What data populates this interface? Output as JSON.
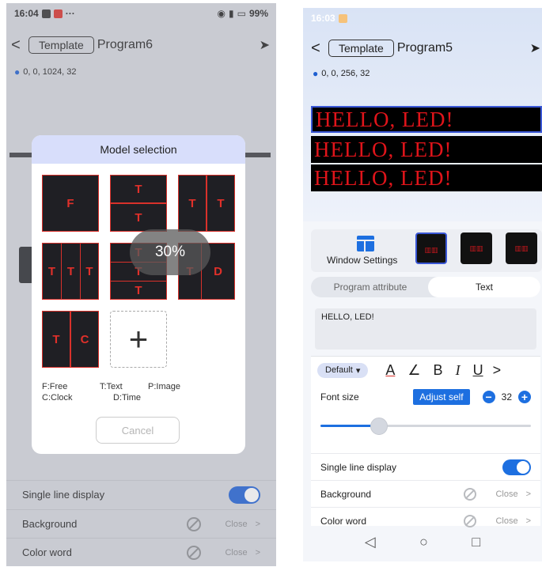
{
  "left": {
    "status": {
      "time": "16:04",
      "battery": "99%",
      "dots": "···"
    },
    "nav": {
      "back": "<",
      "template_label": "Template",
      "title": "Program6",
      "send": "➤"
    },
    "coords": "0, 0, 1024, 32",
    "rows": {
      "single_line": "Single line display",
      "background": "Background",
      "background_value": "Close",
      "color_word": "Color word",
      "color_word_value": "Close",
      "chevron": ">"
    },
    "modal": {
      "title": "Model selection",
      "templates": [
        {
          "cells": [
            "F"
          ]
        },
        {
          "cells": [
            "T",
            "T"
          ]
        },
        {
          "cells": [
            "T",
            "T"
          ]
        },
        {
          "cells": [
            "T",
            "T",
            "T"
          ]
        },
        {
          "cells": [
            "T",
            "T",
            "T"
          ]
        },
        {
          "cells": [
            "T",
            "D"
          ]
        },
        {
          "cells": [
            "T",
            "C"
          ]
        }
      ],
      "add_symbol": "+",
      "legend": {
        "free": "F:Free",
        "text": "T:Text",
        "image": "P:Image",
        "clock": "C:Clock",
        "time": "D:Time"
      },
      "cancel_label": "Cancel"
    },
    "progress": "30%"
  },
  "right": {
    "status": {
      "time": "16:03"
    },
    "nav": {
      "back": "<",
      "template_label": "Template",
      "title": "Program5",
      "send": "➤"
    },
    "coords": "0, 0, 256, 32",
    "led_text": "HELLO, LED!",
    "window_settings_label": "Window Settings",
    "tabs": {
      "attribute": "Program attribute",
      "text": "Text"
    },
    "text_content": "HELLO, LED!",
    "format": {
      "font": "Default",
      "caret": "▾",
      "color": "A",
      "stroke": "∠",
      "bold": "B",
      "italic": "I",
      "underline": "U",
      "more": ">"
    },
    "font_size": {
      "label": "Font size",
      "adjust_label": "Adjust self",
      "value": "32",
      "minus": "−",
      "plus": "+",
      "slider_fraction": 0.28
    },
    "single_line": "Single line display",
    "background": {
      "label": "Background",
      "value": "Close"
    },
    "color_word": {
      "label": "Color word",
      "value": "Close"
    },
    "chevron": ">",
    "sys_nav": {
      "back": "◁",
      "home": "○",
      "recent": "□"
    }
  },
  "colors": {
    "accent": "#1d6fe0",
    "led_red": "#e0141a",
    "modal_header": "#d8defb"
  }
}
